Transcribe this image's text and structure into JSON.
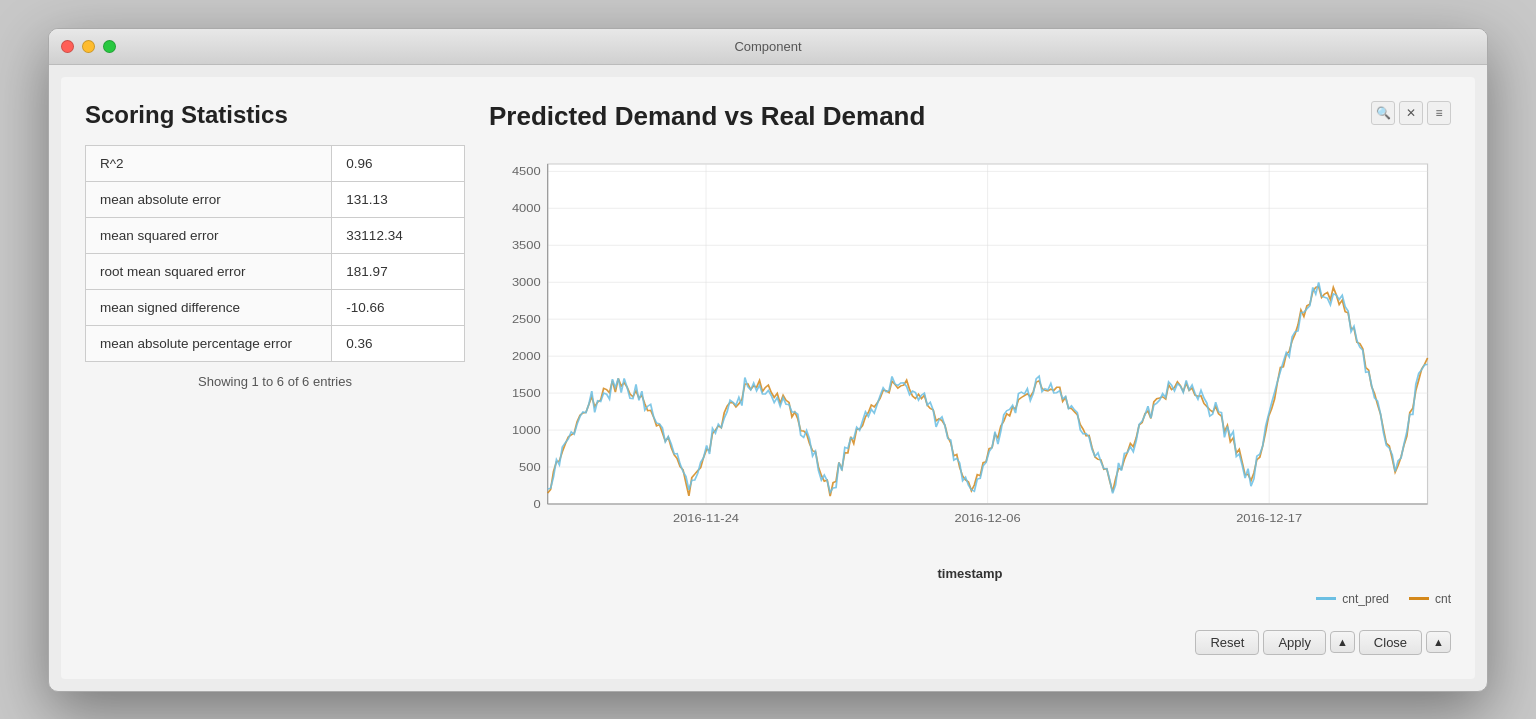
{
  "window": {
    "title": "Component"
  },
  "left_panel": {
    "heading": "Scoring Statistics",
    "stats": [
      {
        "label": "R^2",
        "value": "0.96"
      },
      {
        "label": "mean absolute error",
        "value": "131.13"
      },
      {
        "label": "mean squared error",
        "value": "33112.34"
      },
      {
        "label": "root mean squared error",
        "value": "181.97"
      },
      {
        "label": "mean signed difference",
        "value": "-10.66"
      },
      {
        "label": "mean absolute percentage error",
        "value": "0.36"
      }
    ],
    "entries_info": "Showing 1 to 6 of 6 entries"
  },
  "chart": {
    "title": "Predicted Demand vs Real Demand",
    "x_axis_label": "timestamp",
    "x_ticks": [
      "2016-11-24",
      "2016-12-06",
      "2016-12-17"
    ],
    "y_ticks": [
      "0",
      "500",
      "1000",
      "1500",
      "2000",
      "2500",
      "3000",
      "3500",
      "4000",
      "4500"
    ],
    "legend": [
      {
        "key": "cnt_pred",
        "label": "cnt_pred",
        "color": "#6bbfe3"
      },
      {
        "key": "cnt",
        "label": "cnt",
        "color": "#d4881a"
      }
    ]
  },
  "toolbar": {
    "zoom_icon": "🔍",
    "cross_icon": "✕",
    "menu_icon": "≡"
  },
  "bottom_bar": {
    "reset_label": "Reset",
    "apply_label": "Apply",
    "close_label": "Close",
    "arrow_up": "▲"
  }
}
